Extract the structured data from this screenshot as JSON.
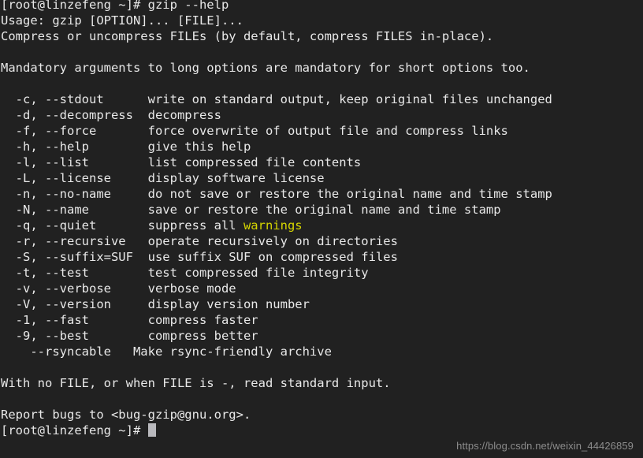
{
  "terminal": {
    "background_color": "#212121",
    "foreground_color": "#e8e8e8",
    "accent_yellow": "#d6d600",
    "cursor_color": "#b9b9bd",
    "prompt_user": "root",
    "prompt_host": "linzefeng",
    "prompt_cwd": "~",
    "prompt_symbol": "#"
  },
  "lines": [
    {
      "id": "l01",
      "text": "[root@linzefeng ~]# gzip --help"
    },
    {
      "id": "l02",
      "text": "Usage: gzip [OPTION]... [FILE]..."
    },
    {
      "id": "l03",
      "text": "Compress or uncompress FILEs (by default, compress FILES in-place)."
    },
    {
      "id": "l04",
      "text": ""
    },
    {
      "id": "l05",
      "text": "Mandatory arguments to long options are mandatory for short options too."
    },
    {
      "id": "l06",
      "text": ""
    },
    {
      "id": "l07",
      "text": "  -c, --stdout      write on standard output, keep original files unchanged"
    },
    {
      "id": "l08",
      "text": "  -d, --decompress  decompress"
    },
    {
      "id": "l09",
      "text": "  -f, --force       force overwrite of output file and compress links"
    },
    {
      "id": "l10",
      "text": "  -h, --help        give this help"
    },
    {
      "id": "l11",
      "text": "  -l, --list        list compressed file contents"
    },
    {
      "id": "l12",
      "text": "  -L, --license     display software license"
    },
    {
      "id": "l13",
      "text": "  -n, --no-name     do not save or restore the original name and time stamp"
    },
    {
      "id": "l14",
      "text": "  -N, --name        save or restore the original name and time stamp"
    },
    {
      "id": "l15",
      "prefix": "  -q, --quiet       suppress all ",
      "highlight": "warnings",
      "suffix": ""
    },
    {
      "id": "l16",
      "text": "  -r, --recursive   operate recursively on directories"
    },
    {
      "id": "l17",
      "text": "  -S, --suffix=SUF  use suffix SUF on compressed files"
    },
    {
      "id": "l18",
      "text": "  -t, --test        test compressed file integrity"
    },
    {
      "id": "l19",
      "text": "  -v, --verbose     verbose mode"
    },
    {
      "id": "l20",
      "text": "  -V, --version     display version number"
    },
    {
      "id": "l21",
      "text": "  -1, --fast        compress faster"
    },
    {
      "id": "l22",
      "text": "  -9, --best        compress better"
    },
    {
      "id": "l23",
      "text": "    --rsyncable   Make rsync-friendly archive"
    },
    {
      "id": "l24",
      "text": ""
    },
    {
      "id": "l25",
      "text": "With no FILE, or when FILE is -, read standard input."
    },
    {
      "id": "l26",
      "text": ""
    },
    {
      "id": "l27",
      "text": "Report bugs to <bug-gzip@gnu.org>."
    }
  ],
  "prompt_line": {
    "text": "[root@linzefeng ~]# ",
    "cursor_visible": true
  },
  "watermark": {
    "text": "https://blog.csdn.net/weixin_44426859"
  }
}
